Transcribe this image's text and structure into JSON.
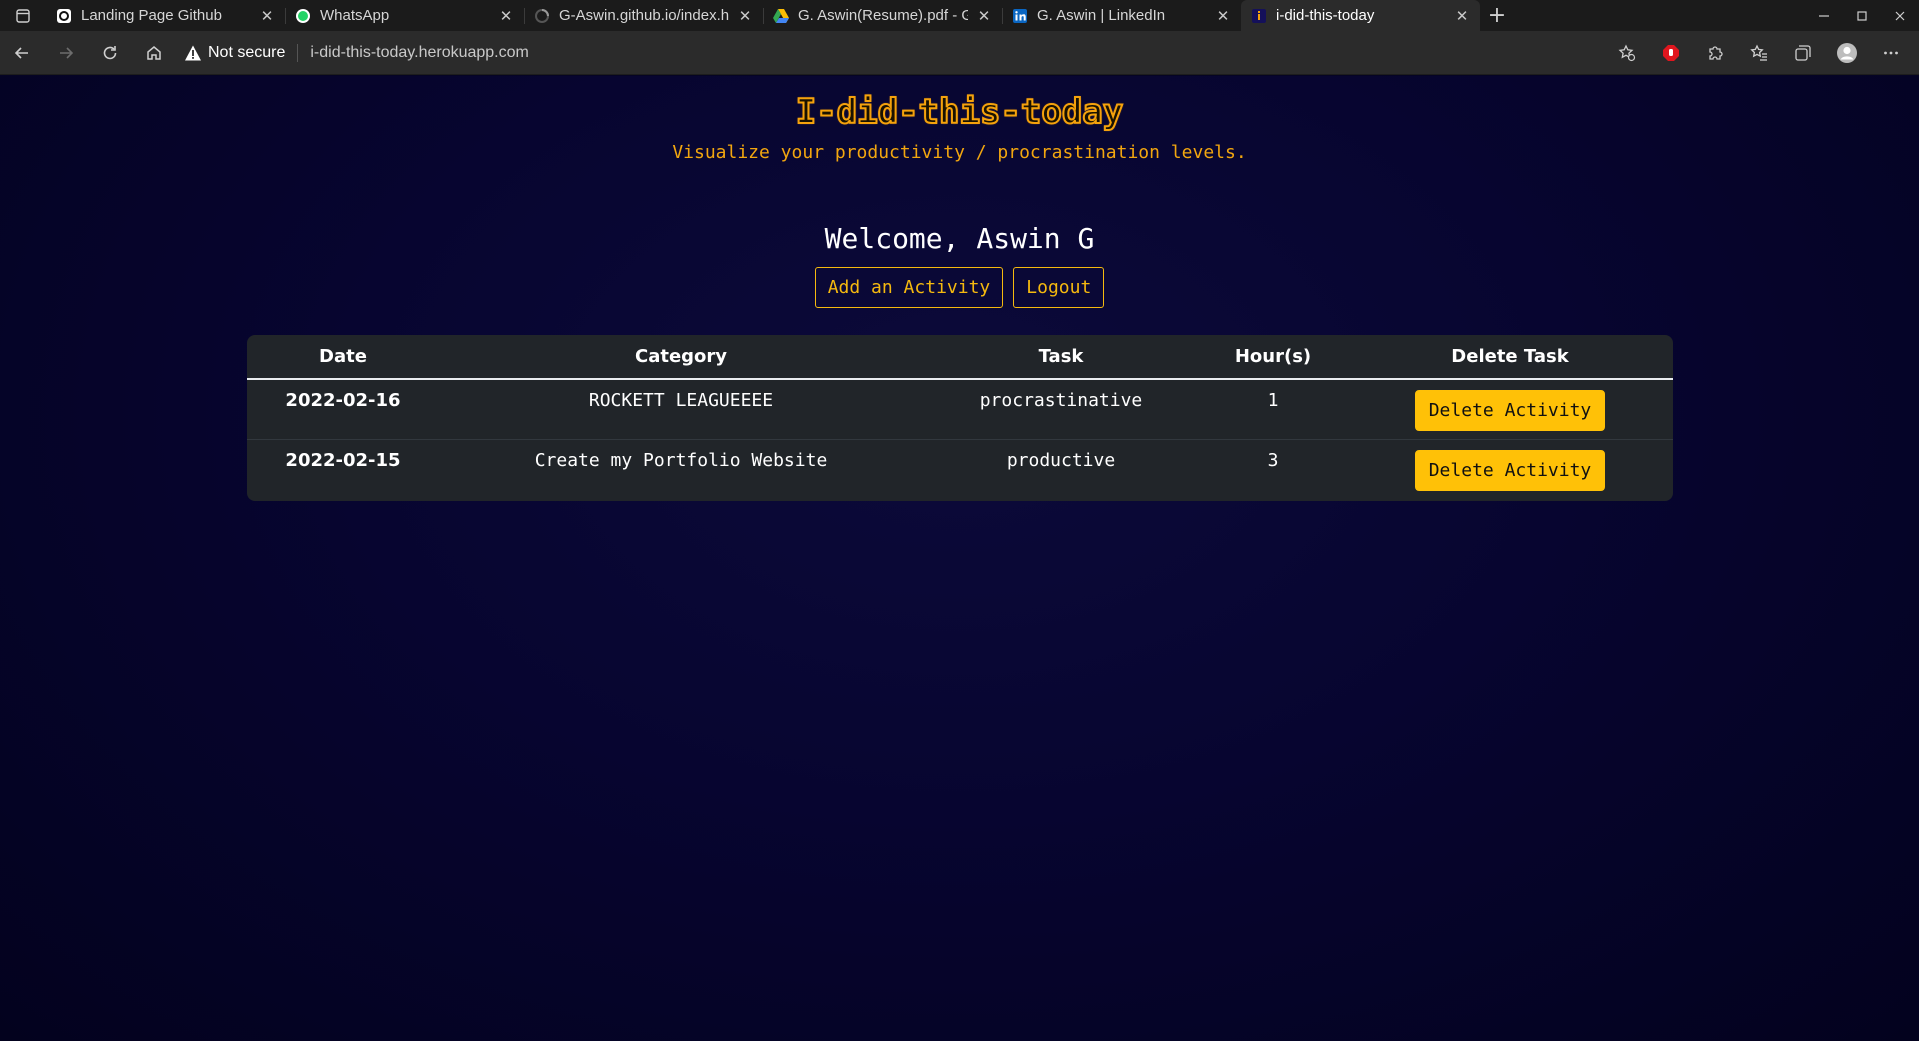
{
  "browser": {
    "tabs": [
      {
        "title": "Landing Page Github",
        "favicon": "github-pages-icon",
        "active": false
      },
      {
        "title": "WhatsApp",
        "favicon": "whatsapp-icon",
        "active": false
      },
      {
        "title": "G-Aswin.github.io/index.h",
        "favicon": "loading-icon",
        "active": false
      },
      {
        "title": "G. Aswin(Resume).pdf - G",
        "favicon": "google-drive-icon",
        "active": false
      },
      {
        "title": "G. Aswin | LinkedIn",
        "favicon": "linkedin-icon",
        "active": false
      },
      {
        "title": "i-did-this-today",
        "favicon": "site-icon",
        "active": true
      }
    ],
    "security_label": "Not secure",
    "url": "i-did-this-today.herokuapp.com"
  },
  "page": {
    "brand": "I-did-this-today",
    "tagline": "Visualize your productivity / procrastination levels.",
    "welcome": "Welcome, Aswin G",
    "add_activity_label": "Add an Activity",
    "logout_label": "Logout"
  },
  "table": {
    "headers": [
      "Date",
      "Category",
      "Task",
      "Hour(s)",
      "Delete Task"
    ],
    "rows": [
      {
        "date": "2022-02-16",
        "category": "ROCKETT LEAGUEEEE",
        "task": "procrastinative",
        "hours": "1",
        "delete_label": "Delete Activity"
      },
      {
        "date": "2022-02-15",
        "category": "Create my Portfolio Website",
        "task": "productive",
        "hours": "3",
        "delete_label": "Delete Activity"
      }
    ]
  },
  "colors": {
    "accent": "#f5b90f",
    "page_bg": "#050424",
    "table_bg": "#212529",
    "delete_button": "#ffc107"
  }
}
